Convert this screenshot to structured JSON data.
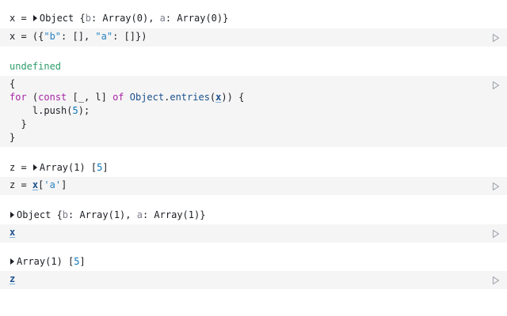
{
  "cells": [
    {
      "output": {
        "prefix": "x = ",
        "summary": "Object {",
        "k1": "b",
        "v1": "Array(0)",
        "sep": ", ",
        "k2": "a",
        "v2": "Array(0)",
        "close": "}"
      },
      "code": {
        "p1": "x = ({",
        "s1": "\"b\"",
        "p2": ": [], ",
        "s2": "\"a\"",
        "p3": ": []})"
      },
      "run_icon": "play-icon"
    },
    {
      "output": {
        "text": "undefined"
      },
      "code": {
        "line1": "{",
        "kw_for": "for",
        "p_open": " (",
        "kw_const": "const",
        "p_destructure": " [_, l] ",
        "kw_of": "of",
        "p_space": " ",
        "fn_obj": "Object",
        "p_dot": ".",
        "fn_entries": "entries",
        "p_paren": "(",
        "ref_x": "x",
        "p_close": ")) {",
        "line3_a": "    l.push(",
        "line3_num": "5",
        "line3_b": ");",
        "line4": "  }",
        "line5": "}"
      },
      "run_icon": "play-icon"
    },
    {
      "output": {
        "prefix": "z = ",
        "summary": "Array(1) [",
        "num": "5",
        "close": "]"
      },
      "code": {
        "p1": "z = ",
        "ref": "x",
        "p2": "[",
        "str": "'a'",
        "p3": "]"
      },
      "run_icon": "play-icon"
    },
    {
      "output": {
        "summary": "Object {",
        "k1": "b",
        "v1": "Array(1)",
        "sep": ", ",
        "k2": "a",
        "v2": "Array(1)",
        "close": "}"
      },
      "code": {
        "ref": "x"
      },
      "run_icon": "play-icon"
    },
    {
      "output": {
        "summary": "Array(1) [",
        "num": "5",
        "close": "]"
      },
      "code": {
        "ref": "z"
      },
      "run_icon": "play-icon"
    }
  ]
}
